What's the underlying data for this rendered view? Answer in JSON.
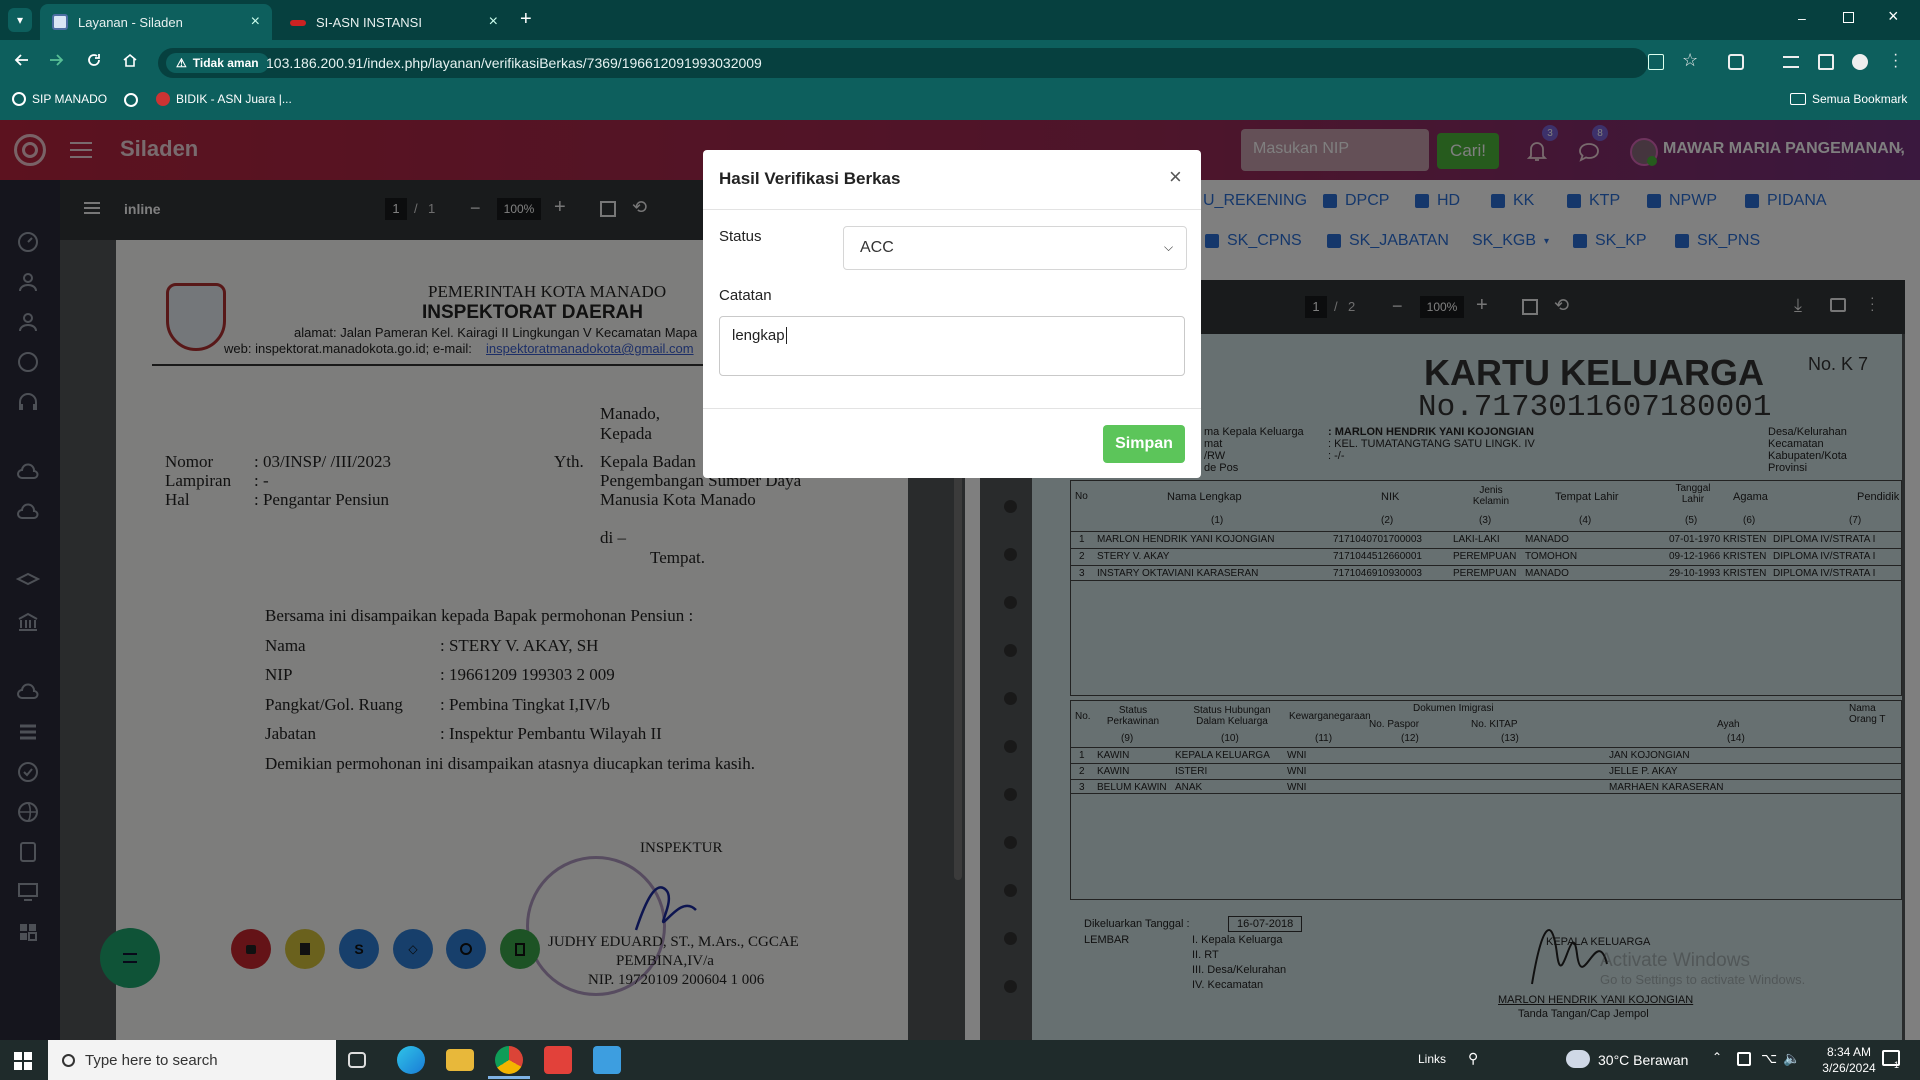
{
  "browser": {
    "tabs": [
      {
        "title": "Layanan - Siladen",
        "active": true
      },
      {
        "title": "SI-ASN INSTANSI",
        "active": false
      }
    ],
    "security_label": "Tidak aman",
    "url": "103.186.200.91/index.php/layanan/verifikasiBerkas/7369/196612091993032009",
    "bookmarks": [
      "SIP MANADO",
      "BIDIK - ASN Juara |..."
    ],
    "all_bookmarks_label": "Semua Bookmark"
  },
  "app": {
    "brand": "Siladen",
    "nip_placeholder": "Masukan NIP",
    "search_button": "Cari!",
    "notif_count": "3",
    "message_count": "8",
    "user_name": "MAWAR MARIA PANGEMANAN,"
  },
  "left_viewer": {
    "file_name": "inline",
    "page_current": "1",
    "page_total": "1",
    "zoom": "100%"
  },
  "letter": {
    "gov": "PEMERINTAH KOTA MANADO",
    "office": "INSPEKTORAT DAERAH",
    "address": "alamat: Jalan Pameran Kel. Kairagi II Lingkungan V Kecamatan Mapa",
    "web": "web: inspektorat.manadokota.go.id; e-mail:",
    "email": "inspektoratmanadokota@gmail.com",
    "place_date": "Manado,",
    "kepada": "Kepada",
    "nomor_label": "Nomor",
    "nomor_value": ": 03/INSP/ /III/2023",
    "lampiran_label": "Lampiran",
    "lampiran_value": ": -",
    "hal_label": "Hal",
    "hal_value": ": Pengantar Pensiun",
    "yth": "Yth.",
    "recipient1": "Kepala Badan",
    "recipient2": "Pengembangan Sumber Daya",
    "recipient3": "Manusia Kota Manado",
    "di": "di –",
    "tempat": "Tempat.",
    "intro": "Bersama ini disampaikan kepada Bapak permohonan Pensiun :",
    "fields": [
      {
        "label": "Nama",
        "value": ": STERY V. AKAY, SH"
      },
      {
        "label": "NIP",
        "value": ": 19661209 199303 2 009"
      },
      {
        "label": "Pangkat/Gol. Ruang",
        "value": ": Pembina Tingkat I,IV/b"
      },
      {
        "label": "Jabatan",
        "value": ": Inspektur Pembantu Wilayah II"
      }
    ],
    "closing": "Demikian permohonan ini disampaikan atasnya diucapkan terima kasih.",
    "signer_title": "INSPEKTUR",
    "signer_name": "JUDHY EDUARD, ST., M.Ars., CGCAE",
    "signer_rank": "PEMBINA,IV/a",
    "signer_nip": "NIP. 19720109 200604 1 006"
  },
  "doc_filters": {
    "row1": [
      "U_REKENING",
      "DPCP",
      "HD",
      "KK",
      "KTP",
      "NPWP",
      "PIDANA"
    ],
    "row2": [
      "SK_CPNS",
      "SK_JABATAN",
      "SK_KGB",
      "SK_KP",
      "SK_PNS"
    ]
  },
  "right_viewer": {
    "page_current": "1",
    "page_total": "2",
    "zoom": "100%"
  },
  "kk": {
    "title": "KARTU KELUARGA",
    "number": "No.7173011607180001",
    "no_label": "No. K 7",
    "head_label": "ma Kepala Keluarga",
    "head_value": ": MARLON HENDRIK YANI KOJONGIAN",
    "addr_label": "mat",
    "addr_value": ": KEL. TUMATANGTANG SATU LINGK. IV",
    "rtrw_label": "/RW",
    "rtrw_value": ": -/-",
    "pos_label": "de Pos",
    "right_labels": [
      "Desa/Kelurahan",
      "Kecamatan",
      "Kabupaten/Kota",
      "Provinsi"
    ],
    "headers1": [
      "No",
      "Nama Lengkap",
      "NIK",
      "Jenis Kelamin",
      "Tempat Lahir",
      "Tanggal Lahir",
      "Agama",
      "Pendidik"
    ],
    "colnums1": [
      "(1)",
      "(2)",
      "(3)",
      "(4)",
      "(5)",
      "(6)",
      "(7)"
    ],
    "rows1": [
      [
        "1",
        "MARLON HENDRIK YANI KOJONGIAN",
        "7171040701700003",
        "LAKI-LAKI",
        "MANADO",
        "07-01-1970",
        "KRISTEN",
        "DIPLOMA IV/STRATA I"
      ],
      [
        "2",
        "STERY V. AKAY",
        "7171044512660001",
        "PEREMPUAN",
        "TOMOHON",
        "09-12-1966",
        "KRISTEN",
        "DIPLOMA IV/STRATA I"
      ],
      [
        "3",
        "INSTARY OKTAVIANI KARASERAN",
        "7171046910930003",
        "PEREMPUAN",
        "MANADO",
        "29-10-1993",
        "KRISTEN",
        "DIPLOMA IV/STRATA I"
      ]
    ],
    "headers2": [
      "No.",
      "Status Perkawinan",
      "Status Hubungan Dalam Keluarga",
      "Kewarganegaraan",
      "Dokumen Imigrasi",
      "No. Paspor",
      "No. KITAP",
      "Nama Orang T",
      "Ayah"
    ],
    "colnums2": [
      "(9)",
      "(10)",
      "(11)",
      "(12)",
      "(13)",
      "(14)"
    ],
    "rows2": [
      [
        "1",
        "KAWIN",
        "KEPALA KELUARGA",
        "WNI",
        "JAN KOJONGIAN"
      ],
      [
        "2",
        "KAWIN",
        "ISTERI",
        "WNI",
        "JELLE P. AKAY"
      ],
      [
        "3",
        "BELUM KAWIN",
        "ANAK",
        "WNI",
        "MARHAEN KARASERAN"
      ]
    ],
    "issued_label": "Dikeluarkan Tanggal :",
    "issued_value": "16-07-2018",
    "lembar": "LEMBAR",
    "lembar_items": [
      "I.   Kepala Keluarga",
      "II.  RT",
      "III. Desa/Kelurahan",
      "IV. Kecamatan"
    ],
    "sign_label": "KEPALA KELUARGA",
    "sign_name": "MARLON HENDRIK YANI KOJONGIAN",
    "sign_caption": "Tanda Tangan/Cap Jempol",
    "watermark1": "Activate Windows",
    "watermark2": "Go to Settings to activate Windows."
  },
  "modal": {
    "title": "Hasil Verifikasi Berkas",
    "status_label": "Status",
    "status_value": "ACC",
    "notes_label": "Catatan",
    "notes_value": "lengkap",
    "save_button": "Simpan"
  },
  "taskbar": {
    "search_placeholder": "Type here to search",
    "links_label": "Links",
    "weather": "30°C  Berawan",
    "time": "8:34 AM",
    "date": "3/26/2024",
    "notif_count": "1"
  }
}
